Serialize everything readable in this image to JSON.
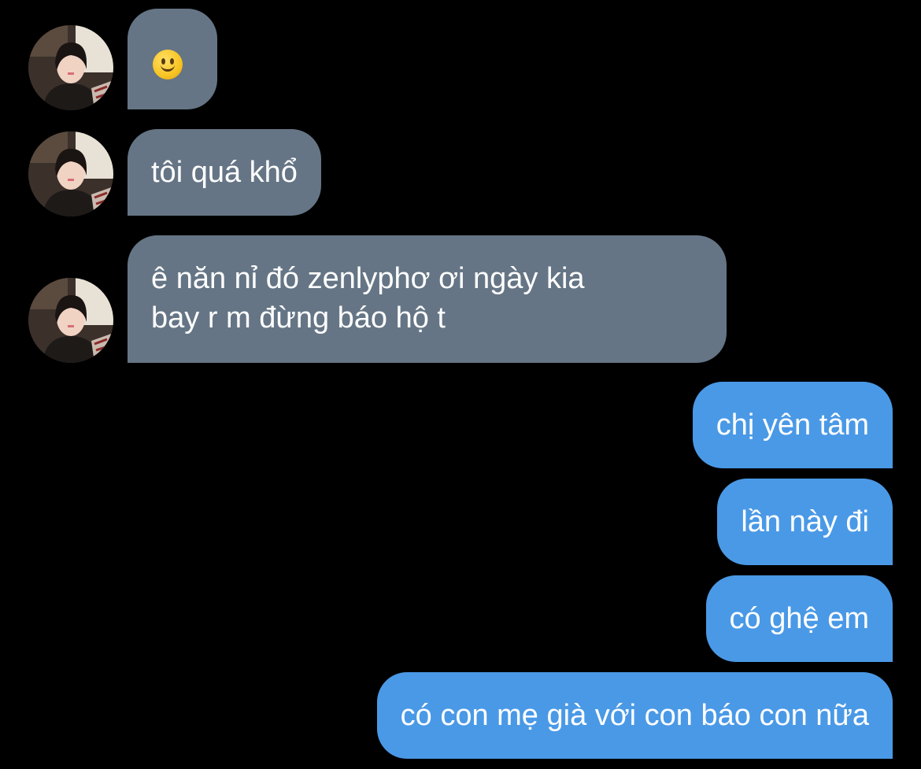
{
  "chat": {
    "incoming": [
      {
        "id": "m1",
        "emoji": "slightly-smiling-face"
      },
      {
        "id": "m2",
        "text": "tôi quá khổ"
      },
      {
        "id": "m3",
        "text": "ê năn nỉ đó zenlyphơ ơi ngày kia\nbay r m đừng báo hộ t"
      }
    ],
    "outgoing": [
      {
        "id": "m4",
        "text": "chị yên tâm"
      },
      {
        "id": "m5",
        "text": "lần này đi"
      },
      {
        "id": "m6",
        "text": "có ghệ em"
      },
      {
        "id": "m7",
        "text": "có con mẹ già với con báo con nữa"
      }
    ]
  },
  "colors": {
    "background": "#000000",
    "incoming_bubble": "#657585",
    "outgoing_bubble": "#4a99e6",
    "text": "#ffffff"
  }
}
